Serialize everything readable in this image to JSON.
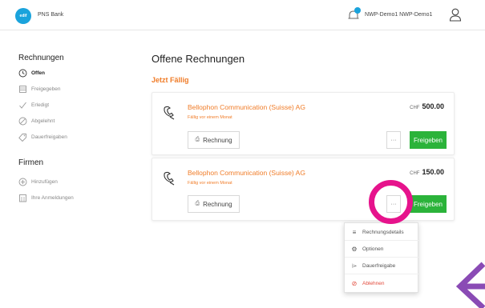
{
  "header": {
    "logo_text": "edif",
    "bank_name": "PNS Bank",
    "user_name": "NWP-Demo1 NWP-Demo1"
  },
  "sidebar": {
    "section1_title": "Rechnungen",
    "items1": [
      {
        "label": "Offen",
        "icon": "clock-icon",
        "active": true
      },
      {
        "label": "Freigegeben",
        "icon": "inbox-icon",
        "active": false
      },
      {
        "label": "Erledigt",
        "icon": "check-icon",
        "active": false
      },
      {
        "label": "Abgelehnt",
        "icon": "ban-icon",
        "active": false
      },
      {
        "label": "Dauerfreigaben",
        "icon": "tag-icon",
        "active": false
      }
    ],
    "section2_title": "Firmen",
    "items2": [
      {
        "label": "Hinzufügen",
        "icon": "plus-circle-icon"
      },
      {
        "label": "Ihre Anmeldungen",
        "icon": "building-icon"
      }
    ]
  },
  "main": {
    "title": "Offene Rechnungen",
    "section_title": "Jetzt Fällig",
    "invoices": [
      {
        "company": "Bellophon Communication (Suisse) AG",
        "due": "Fällig vor einem Monat",
        "currency": "CHF",
        "amount": "500.00",
        "invoice_label": "Rechnung",
        "more_label": "···",
        "approve_label": "Freigeben"
      },
      {
        "company": "Bellophon Communication (Suisse) AG",
        "due": "Fällig vor einem Monat",
        "currency": "CHF",
        "amount": "150.00",
        "invoice_label": "Rechnung",
        "more_label": "···",
        "approve_label": "Freigeben"
      }
    ]
  },
  "dropdown": {
    "items": [
      {
        "label": "Rechnungsdetails",
        "icon": "list-icon"
      },
      {
        "label": "Optionen",
        "icon": "gear-icon"
      },
      {
        "label": "Dauerfreigabe",
        "icon": "tag-icon"
      },
      {
        "label": "Ablehnen",
        "icon": "ban-icon"
      }
    ]
  },
  "colors": {
    "accent_orange": "#f07c28",
    "approve_green": "#2bb33a",
    "logo_blue": "#1aa3dc",
    "highlight_magenta": "#e6138c",
    "arrow_purple": "#8a4bb5",
    "danger_red": "#e24a3b"
  }
}
